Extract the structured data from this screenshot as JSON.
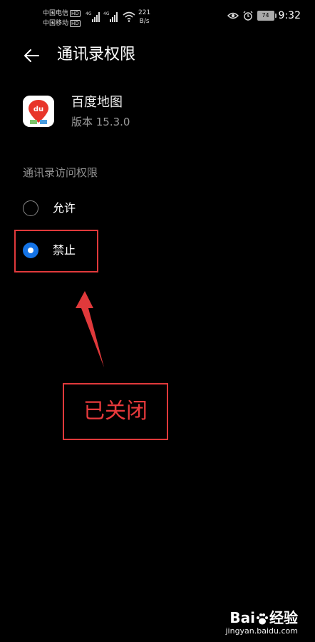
{
  "status_bar": {
    "carrier1": "中国电信",
    "carrier2": "中国移动",
    "hd_badge": "HD",
    "net1": "4G",
    "net2": "4G",
    "speed_value": "221",
    "speed_unit": "B/s",
    "battery_level": "74",
    "time": "9:32",
    "icons": [
      "signal-icon",
      "wifi-icon",
      "eye-icon",
      "alarm-icon",
      "battery-icon"
    ]
  },
  "header": {
    "title": "通讯录权限",
    "back_icon": "back-arrow-icon"
  },
  "app": {
    "name": "百度地图",
    "version": "版本 15.3.0",
    "icon_text": "du"
  },
  "section": {
    "label": "通讯录访问权限"
  },
  "options": [
    {
      "label": "允许",
      "selected": false
    },
    {
      "label": "禁止",
      "selected": true
    }
  ],
  "annotation": {
    "callout_text": "已关闭",
    "color": "#e0393b"
  },
  "watermark": {
    "brand_left": "Bai",
    "brand_right": "经验",
    "url": "jingyan.baidu.com"
  },
  "colors": {
    "background": "#000000",
    "accent": "#1473e6",
    "annotation_red": "#e0393b"
  }
}
